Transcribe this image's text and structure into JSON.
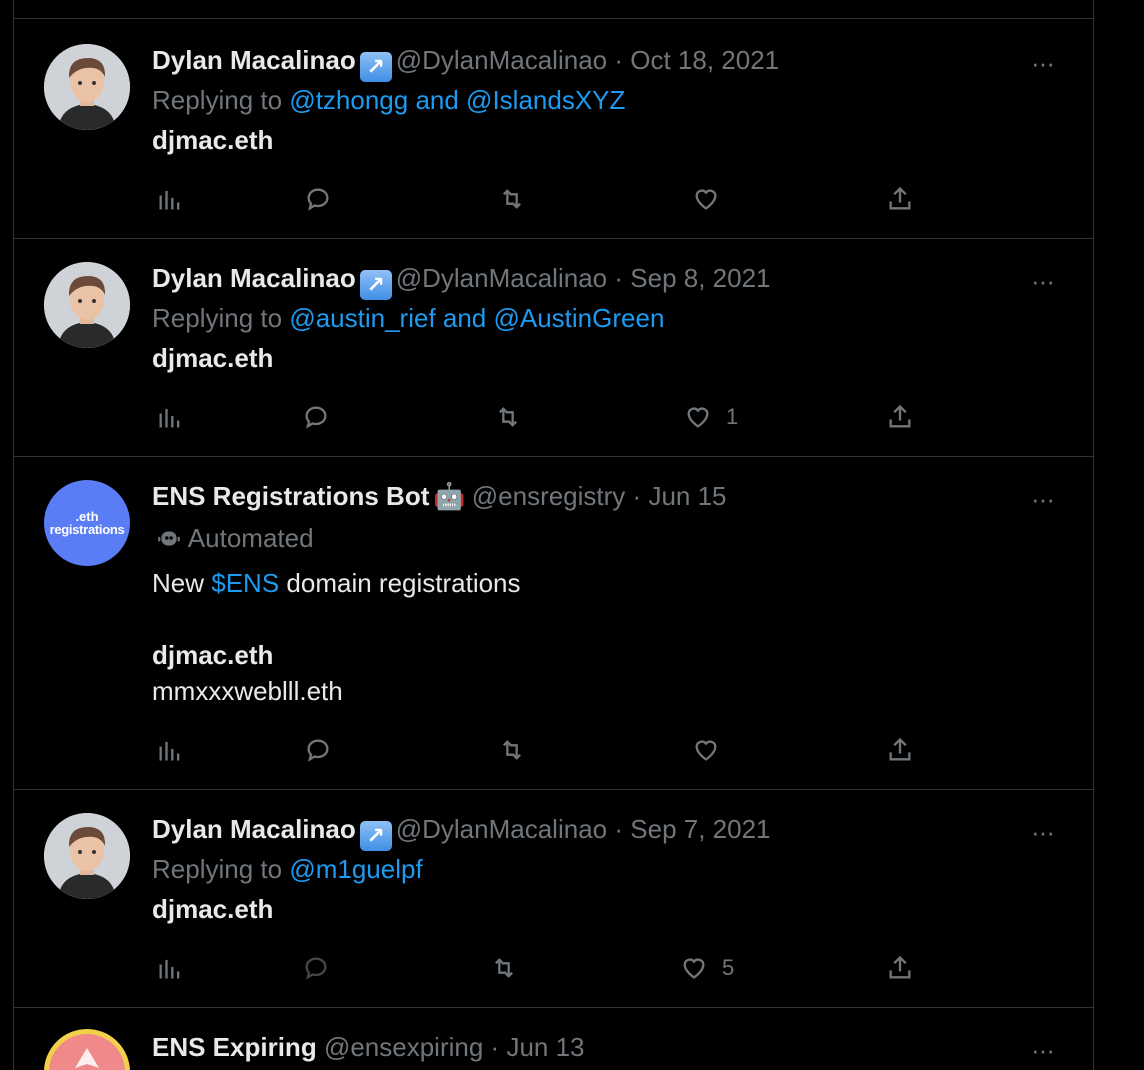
{
  "tweets": [
    {
      "name": "Dylan Macalinao",
      "handle": "@DylanMacalinao",
      "date": "Oct 18, 2021",
      "replying": "Replying to",
      "mentions": "@tzhongg and @IslandsXYZ",
      "body": "djmac.eth",
      "likes": ""
    },
    {
      "name": "Dylan Macalinao",
      "handle": "@DylanMacalinao",
      "date": "Sep 8, 2021",
      "replying": "Replying to",
      "mentions": "@austin_rief and @AustinGreen",
      "body": "djmac.eth",
      "likes": "1"
    },
    {
      "name": "ENS Registrations Bot",
      "handle": "@ensregistry",
      "date": "Jun 15",
      "automated": "Automated",
      "avatar_line1": ".eth",
      "avatar_line2": "registrations",
      "text_prefix": "New",
      "cashtag": "$ENS",
      "text_suffix": "domain registrations",
      "domain1": "djmac.eth",
      "domain2": "mmxxxweblll.eth",
      "likes": ""
    },
    {
      "name": "Dylan Macalinao",
      "handle": "@DylanMacalinao",
      "date": "Sep 7, 2021",
      "replying": "Replying to",
      "mentions": "@m1guelpf",
      "body": "djmac.eth",
      "likes": "5"
    },
    {
      "name": "ENS Expiring",
      "handle": "@ensexpiring",
      "date": "Jun 13"
    }
  ],
  "separator": "·",
  "more": "···",
  "verified_badge": "↗",
  "colors": {
    "background": "#000000",
    "accent": "#1d9bf0",
    "muted": "#71767b",
    "text": "#e7e9ea"
  }
}
